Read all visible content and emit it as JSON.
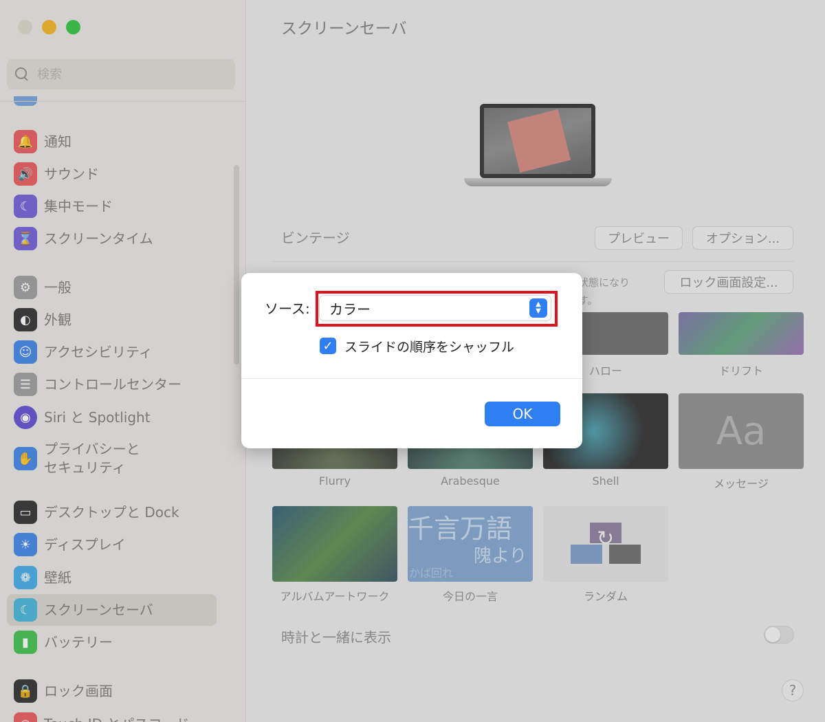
{
  "sidebar": {
    "search_placeholder": "検索",
    "items": [
      {
        "label": "通知",
        "icon": "bell-icon",
        "color": "#e8565a"
      },
      {
        "label": "サウンド",
        "icon": "speaker-icon",
        "color": "#e8565a"
      },
      {
        "label": "集中モード",
        "icon": "moon-icon",
        "color": "#6e5bd6"
      },
      {
        "label": "スクリーンタイム",
        "icon": "hourglass-icon",
        "color": "#6e5bd6"
      },
      {
        "label": "一般",
        "icon": "gear-icon",
        "color": "#9a9a9a"
      },
      {
        "label": "外観",
        "icon": "appearance-icon",
        "color": "#2b2b2b"
      },
      {
        "label": "アクセシビリティ",
        "icon": "accessibility-icon",
        "color": "#3b82e6"
      },
      {
        "label": "コントロールセンター",
        "icon": "toggles-icon",
        "color": "#9a9a9a"
      },
      {
        "label": "Siri と Spotlight",
        "icon": "siri-icon",
        "color": "#5b4bd1"
      },
      {
        "label": "プライバシーと\nセキュリティ",
        "icon": "hand-icon",
        "color": "#3b82e6"
      },
      {
        "label": "デスクトップと Dock",
        "icon": "dock-icon",
        "color": "#2b2b2b"
      },
      {
        "label": "ディスプレイ",
        "icon": "sun-icon",
        "color": "#3b82e6"
      },
      {
        "label": "壁紙",
        "icon": "flower-icon",
        "color": "#3fa9e6"
      },
      {
        "label": "スクリーンセーバ",
        "icon": "screensaver-icon",
        "color": "#3fb4d8"
      },
      {
        "label": "バッテリー",
        "icon": "battery-icon",
        "color": "#3cbf4a"
      },
      {
        "label": "ロック画面",
        "icon": "lock-icon",
        "color": "#2b2b2b"
      },
      {
        "label": "Touch ID とパスコード",
        "icon": "fingerprint-icon",
        "color": "#e8565a"
      }
    ]
  },
  "main": {
    "title": "スクリーンセーバ",
    "current_saver": "ビンテージ",
    "preview_button": "プレビュー",
    "options_button": "オプション...",
    "lock_text_1": "状態になり",
    "lock_text_2": "す。",
    "lock_button": "ロック画面設定...",
    "savers_row1": [
      "ハロー",
      "ドリフト"
    ],
    "savers_row2": [
      "Flurry",
      "Arabesque",
      "Shell",
      "メッセージ"
    ],
    "savers_row3": [
      "アルバムアートワーク",
      "今日の一言",
      "ランダム"
    ],
    "message_preview": "Aa",
    "quote_line1": "千言万語",
    "quote_line2": "隗より",
    "quote_line3": "かば回れ",
    "clock_label": "時計と一緒に表示",
    "help": "?"
  },
  "dialog": {
    "source_label": "ソース:",
    "source_value": "カラー",
    "shuffle_label": "スライドの順序をシャッフル",
    "shuffle_checked": true,
    "ok": "OK"
  }
}
